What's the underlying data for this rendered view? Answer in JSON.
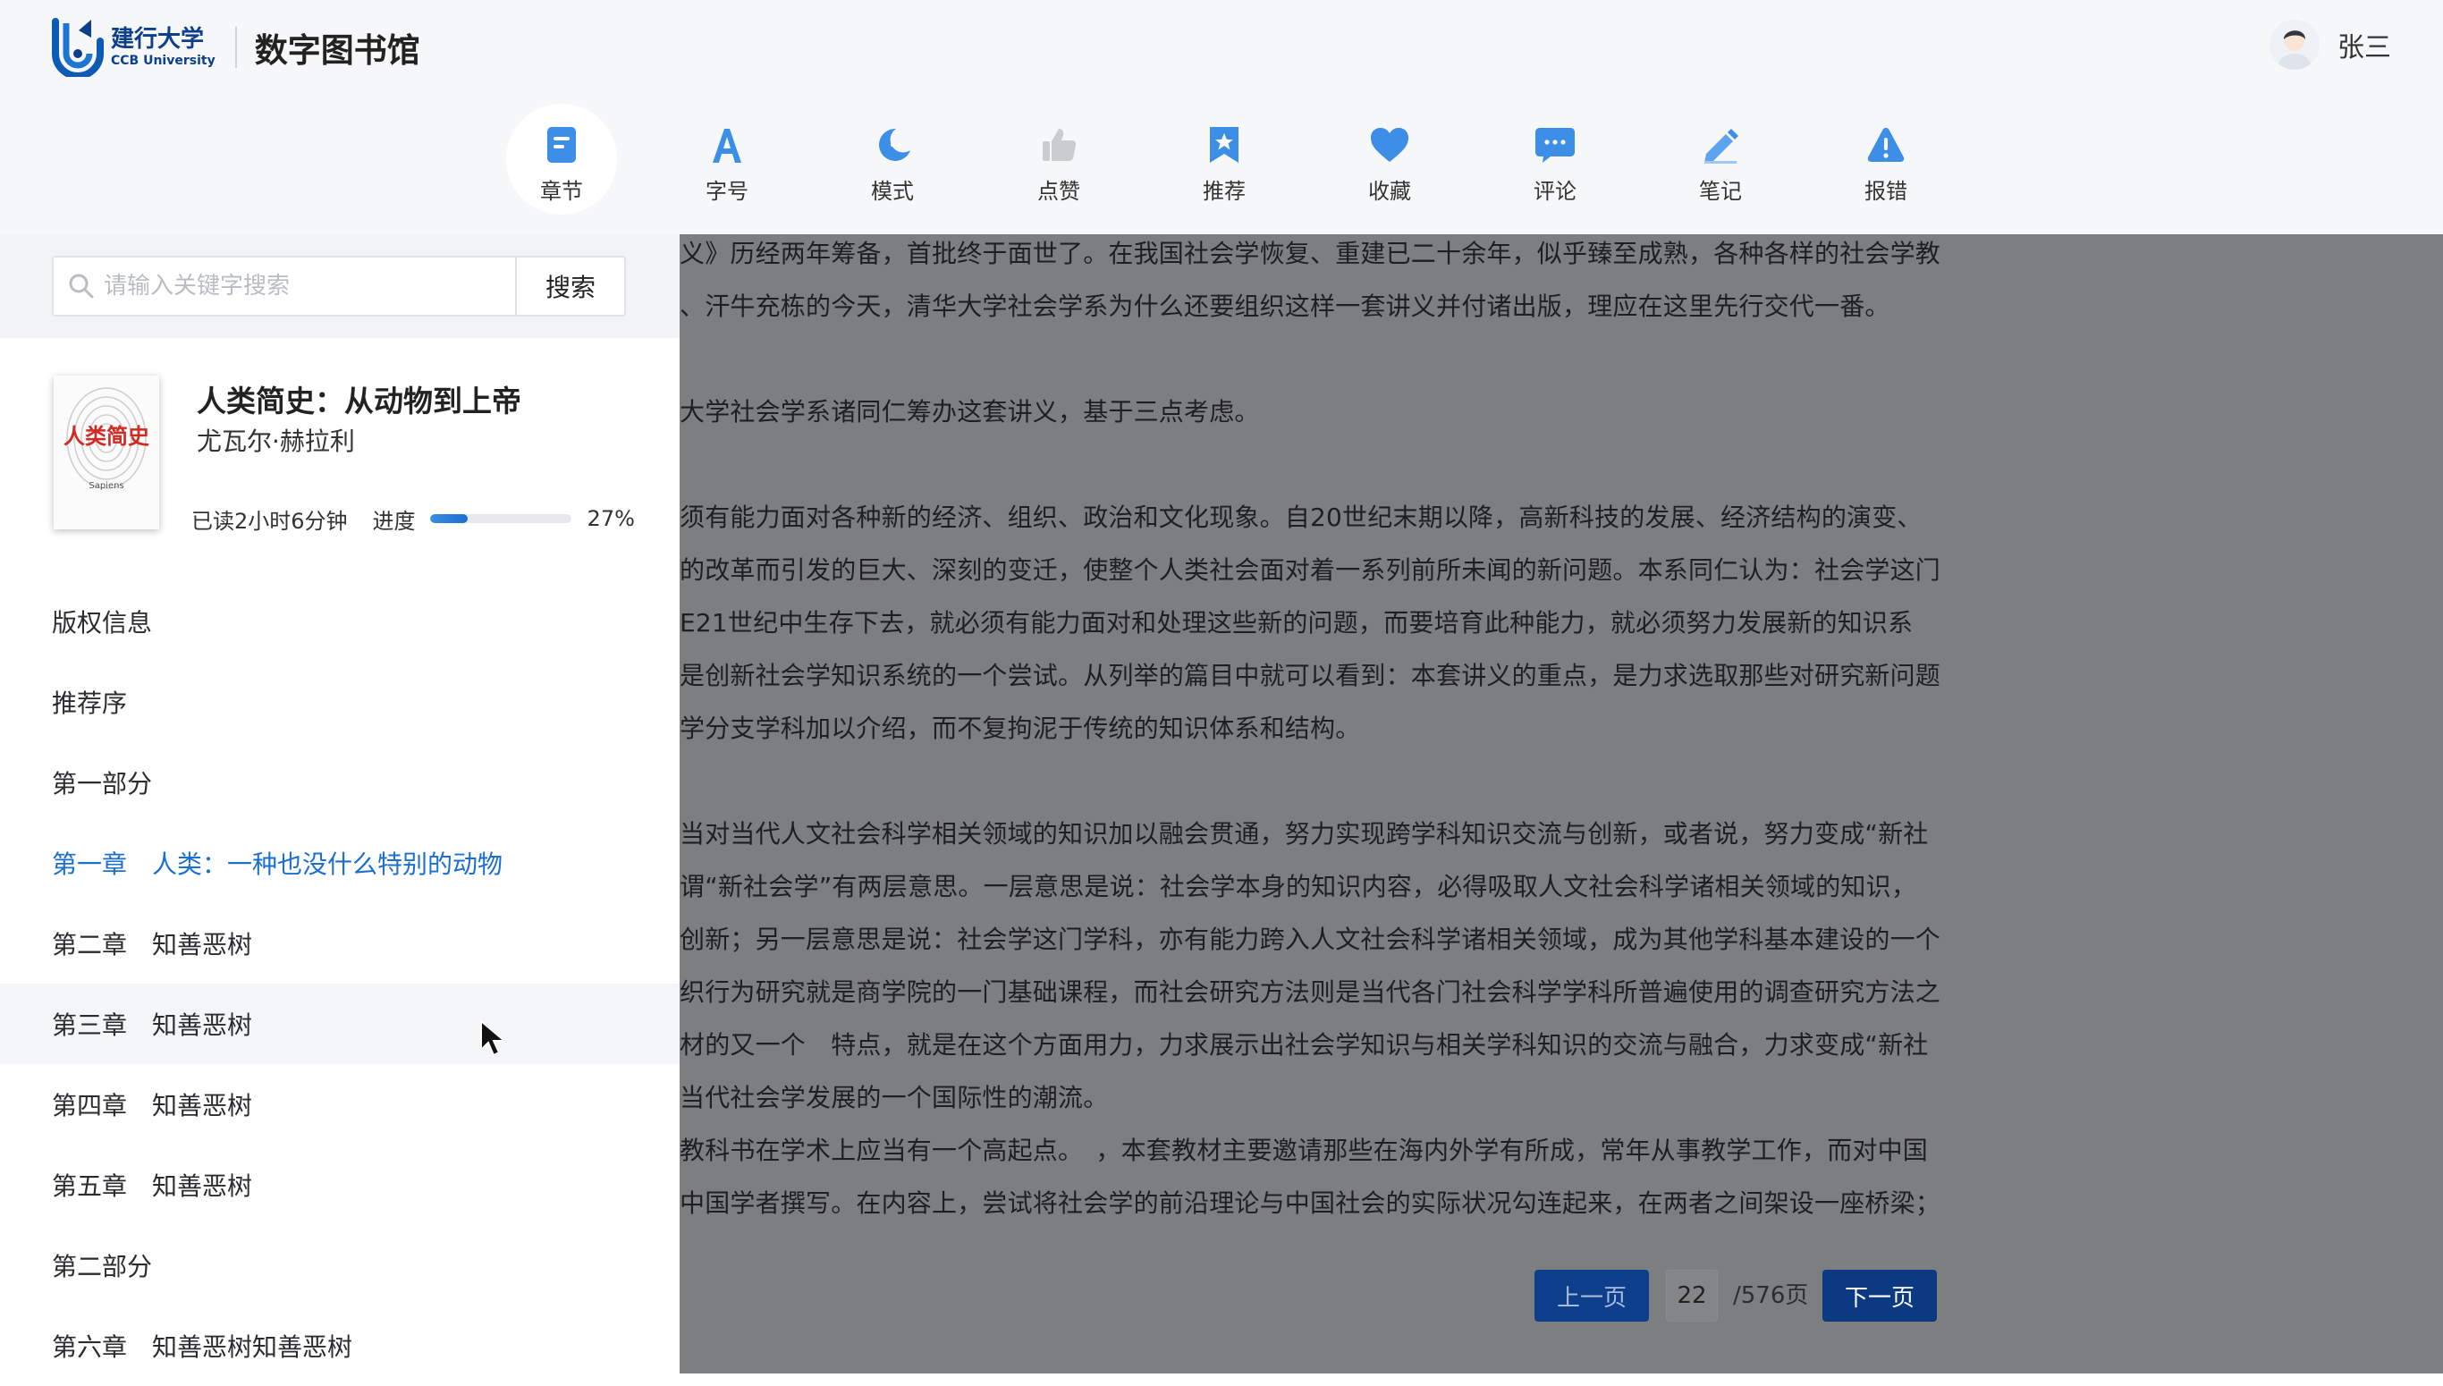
{
  "header": {
    "logo_cn": "建行大学",
    "logo_en": "CCB University",
    "app_title": "数字图书馆",
    "user_name": "张三"
  },
  "toolbar": {
    "active": "章节",
    "items": [
      {
        "label": "章节",
        "icon": "chapter-icon"
      },
      {
        "label": "字号",
        "icon": "font-size-icon"
      },
      {
        "label": "模式",
        "icon": "moon-icon"
      },
      {
        "label": "点赞",
        "icon": "thumbs-up-icon"
      },
      {
        "label": "推荐",
        "icon": "bookmark-star-icon"
      },
      {
        "label": "收藏",
        "icon": "heart-icon"
      },
      {
        "label": "评论",
        "icon": "comment-icon"
      },
      {
        "label": "笔记",
        "icon": "pencil-icon"
      },
      {
        "label": "报错",
        "icon": "warning-icon"
      }
    ]
  },
  "sidebar": {
    "search": {
      "placeholder": "请输入关键字搜索",
      "button": "搜索"
    },
    "book": {
      "cover_title": "人类简史",
      "cover_subtitle": "Sapiens",
      "title": "人类简史：从动物到上帝",
      "author": "尤瓦尔·赫拉利",
      "read_time": "已读2小时6分钟",
      "progress_label": "进度",
      "progress_value": 0.27,
      "progress_text": "27%"
    },
    "toc": [
      {
        "num": "版权信息",
        "name": ""
      },
      {
        "num": "推荐序",
        "name": ""
      },
      {
        "num": "第一部分",
        "name": ""
      },
      {
        "num": "第一章",
        "name": "人类：一种也没什么特别的动物",
        "current": true
      },
      {
        "num": "第二章",
        "name": "知善恶树"
      },
      {
        "num": "第三章",
        "name": "知善恶树",
        "hover": true
      },
      {
        "num": "第四章",
        "name": "知善恶树"
      },
      {
        "num": "第五章",
        "name": "知善恶树"
      },
      {
        "num": "第二部分",
        "name": ""
      },
      {
        "num": "第六章",
        "name": "知善恶树知善恶树"
      }
    ]
  },
  "content": {
    "lines": [
      "义》历经两年筹备，首批终于面世了。在我国社会学恢复、重建已二十余年，似乎臻至成熟，各种各样的社会学教",
      "、汗牛充栋的今天，清华大学社会学系为什么还要组织这样一套讲义并付诸出版，理应在这里先行交代一番。",
      "大学社会学系诸同仁筹办这套讲义，基于三点考虑。",
      "须有能力面对各种新的经济、组织、政治和文化现象。自20世纪末期以降，高新科技的发展、经济结构的演变、",
      "的改革而引发的巨大、深刻的变迁，使整个人类社会面对着一系列前所未闻的新问题。本系同仁认为：社会学这门",
      "E21世纪中生存下去，就必须有能力面对和处理这些新的问题，而要培育此种能力，就必须努力发展新的知识系",
      "是创新社会学知识系统的一个尝试。从列举的篇目中就可以看到：本套讲义的重点，是力求选取那些对研究新问题",
      "学分支学科加以介绍，而不复拘泥于传统的知识体系和结构。",
      "当对当代人文社会科学相关领域的知识加以融会贯通，努力实现跨学科知识交流与创新，或者说，努力变成“新社",
      "谓“新社会学”有两层意思。一层意思是说：社会学本身的知识内容，必得吸取人文社会科学诸相关领域的知识，",
      "创新；另一层意思是说：社会学这门学科，亦有能力跨入人文社会科学诸相关领域，成为其他学科基本建设的一个",
      "织行为研究就是商学院的一门基础课程，而社会研究方法则是当代各门社会科学学科所普遍使用的调查研究方法之",
      "材的又一个　特点，就是在这个方面用力，力求展示出社会学知识与相关学科知识的交流与融合，力求变成“新社",
      "当代社会学发展的一个国际性的潮流。",
      "教科书在学术上应当有一个高起点。　，本套教材主要邀请那些在海内外学有所成，常年从事教学工作，而对中国",
      "中国学者撰写。在内容上，尝试将社会学的前沿理论与中国社会的实际状况勾连起来，在两者之间架设一座桥梁；"
    ],
    "pager": {
      "prev": "上一页",
      "current_page": "22",
      "total": "/576页",
      "next": "下一页"
    }
  },
  "colors": {
    "brand": "#0d3f8c",
    "accent": "#1a6fcf",
    "icon_blue": "#3d8ee6",
    "overlay": "#7d7e80"
  }
}
